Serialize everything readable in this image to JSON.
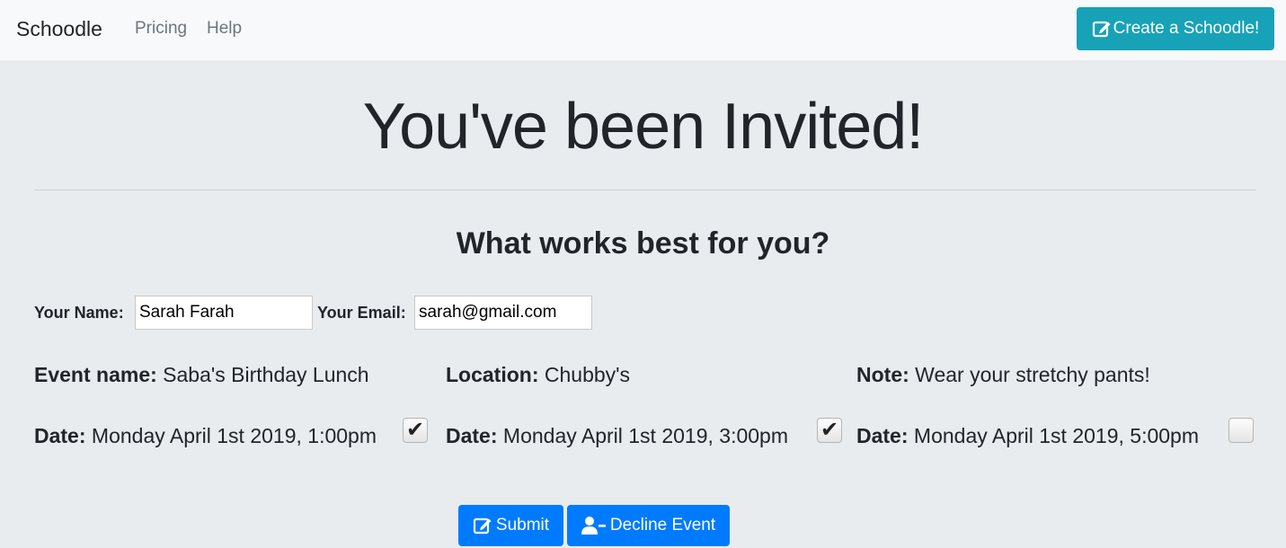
{
  "navbar": {
    "brand": "Schoodle",
    "links": [
      "Pricing",
      "Help"
    ],
    "create_button": "Create a Schoodle!"
  },
  "hero": {
    "title": "You've been Invited!",
    "subtitle": "What works best for you?"
  },
  "form": {
    "name_label": "Your Name:",
    "name_value": "Sarah Farah",
    "email_label": "Your Email:",
    "email_value": "sarah@gmail.com"
  },
  "event": {
    "name_label": "Event name:",
    "name_value": " Saba's Birthday Lunch",
    "location_label": "Location:",
    "location_value": " Chubby's",
    "note_label": "Note:",
    "note_value": " Wear your stretchy pants!"
  },
  "dates": [
    {
      "label": "Date:",
      "value": " Monday April 1st 2019, 1:00pm",
      "checked": true
    },
    {
      "label": "Date:",
      "value": " Monday April 1st 2019, 3:00pm",
      "checked": true
    },
    {
      "label": "Date:",
      "value": " Monday April 1st 2019, 5:00pm",
      "checked": false
    }
  ],
  "actions": {
    "submit": "Submit",
    "decline": "Decline Event"
  },
  "colors": {
    "navbar_bg": "#f8f9fa",
    "page_bg": "#e9ecef",
    "info_button": "#17a2b8",
    "primary_button": "#007bff"
  },
  "icons": {
    "create": "edit-icon",
    "submit": "edit-icon",
    "decline": "user-minus-icon"
  }
}
